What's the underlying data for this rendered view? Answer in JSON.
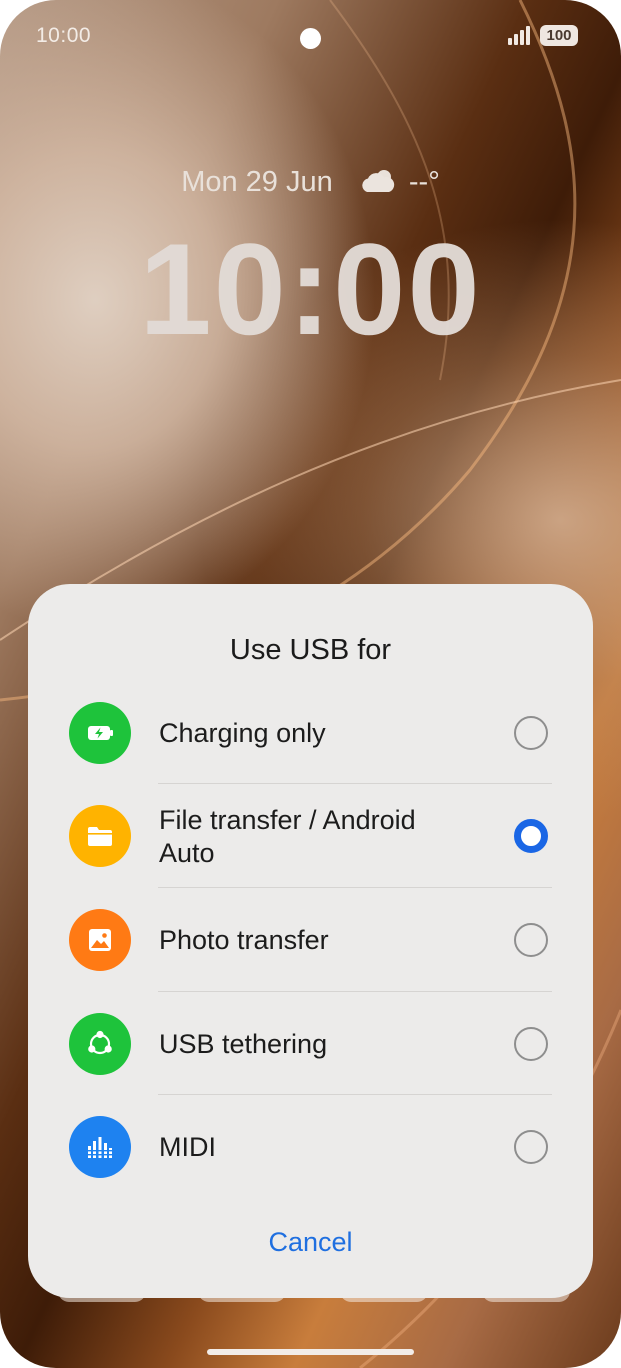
{
  "status_bar": {
    "time": "10:00",
    "battery": "100"
  },
  "lock_screen": {
    "date": "Mon 29 Jun",
    "weather": "--°",
    "clock": "10:00"
  },
  "dialog": {
    "title": "Use USB for",
    "options": [
      {
        "label": "Charging only",
        "icon": "battery-charging-icon",
        "color": "#1ec33b",
        "selected": false
      },
      {
        "label": "File transfer / Android Auto",
        "icon": "folder-icon",
        "color": "#ffb300",
        "selected": true
      },
      {
        "label": "Photo transfer",
        "icon": "image-icon",
        "color": "#ff7a14",
        "selected": false
      },
      {
        "label": "USB tethering",
        "icon": "share-nodes-icon",
        "color": "#1ec33b",
        "selected": false
      },
      {
        "label": "MIDI",
        "icon": "equalizer-icon",
        "color": "#1e82f0",
        "selected": false
      }
    ],
    "cancel_label": "Cancel"
  },
  "colors": {
    "accent": "#1a66e5",
    "cancel_text": "#1f6fe0"
  }
}
